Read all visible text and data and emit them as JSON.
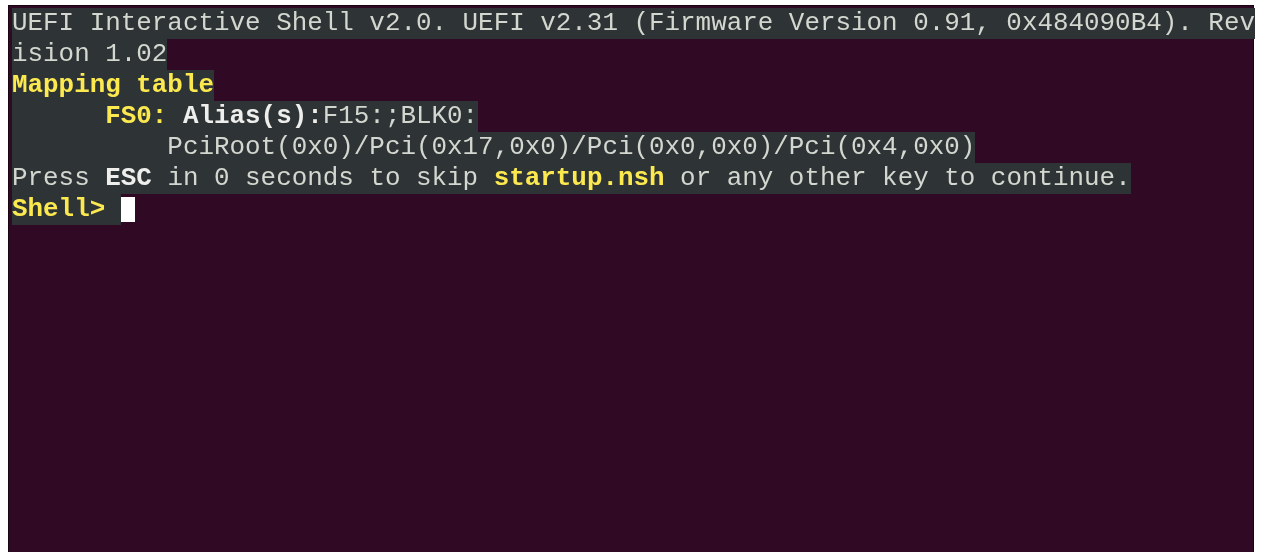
{
  "terminal": {
    "lines": [
      {
        "kind": "text",
        "cursor": false,
        "segments": [
          {
            "kind": "plain",
            "text": "UEFI Interactive Shell v2.0. UEFI v2.31 (Firmware Version 0.91, 0x484090B4). Rev"
          }
        ]
      },
      {
        "kind": "text",
        "cursor": false,
        "segments": [
          {
            "kind": "plain",
            "text": "ision 1.02"
          }
        ]
      },
      {
        "kind": "text",
        "cursor": false,
        "segments": [
          {
            "kind": "yellow",
            "text": "Mapping table"
          }
        ]
      },
      {
        "kind": "entry",
        "cursor": false,
        "segments": [
          {
            "kind": "yellow",
            "text": "FS0: "
          },
          {
            "kind": "bold",
            "text": "Alias(s):"
          },
          {
            "kind": "plain",
            "text": "F15:;BLK0:"
          }
        ]
      },
      {
        "kind": "path",
        "cursor": false,
        "segments": [
          {
            "kind": "plain",
            "text": "PciRoot(0x0)/Pci(0x17,0x0)/Pci(0x0,0x0)/Pci(0x4,0x0)"
          }
        ]
      },
      {
        "kind": "text",
        "cursor": false,
        "segments": [
          {
            "kind": "plain",
            "text": "Press "
          },
          {
            "kind": "bold",
            "text": "ESC"
          },
          {
            "kind": "plain",
            "text": " in 0 seconds to skip "
          },
          {
            "kind": "yellow",
            "text": "startup.nsh"
          },
          {
            "kind": "plain",
            "text": " or any other key to continue."
          }
        ]
      },
      {
        "kind": "text",
        "cursor": true,
        "segments": [
          {
            "kind": "yellow",
            "text": "Shell> "
          }
        ]
      }
    ]
  }
}
